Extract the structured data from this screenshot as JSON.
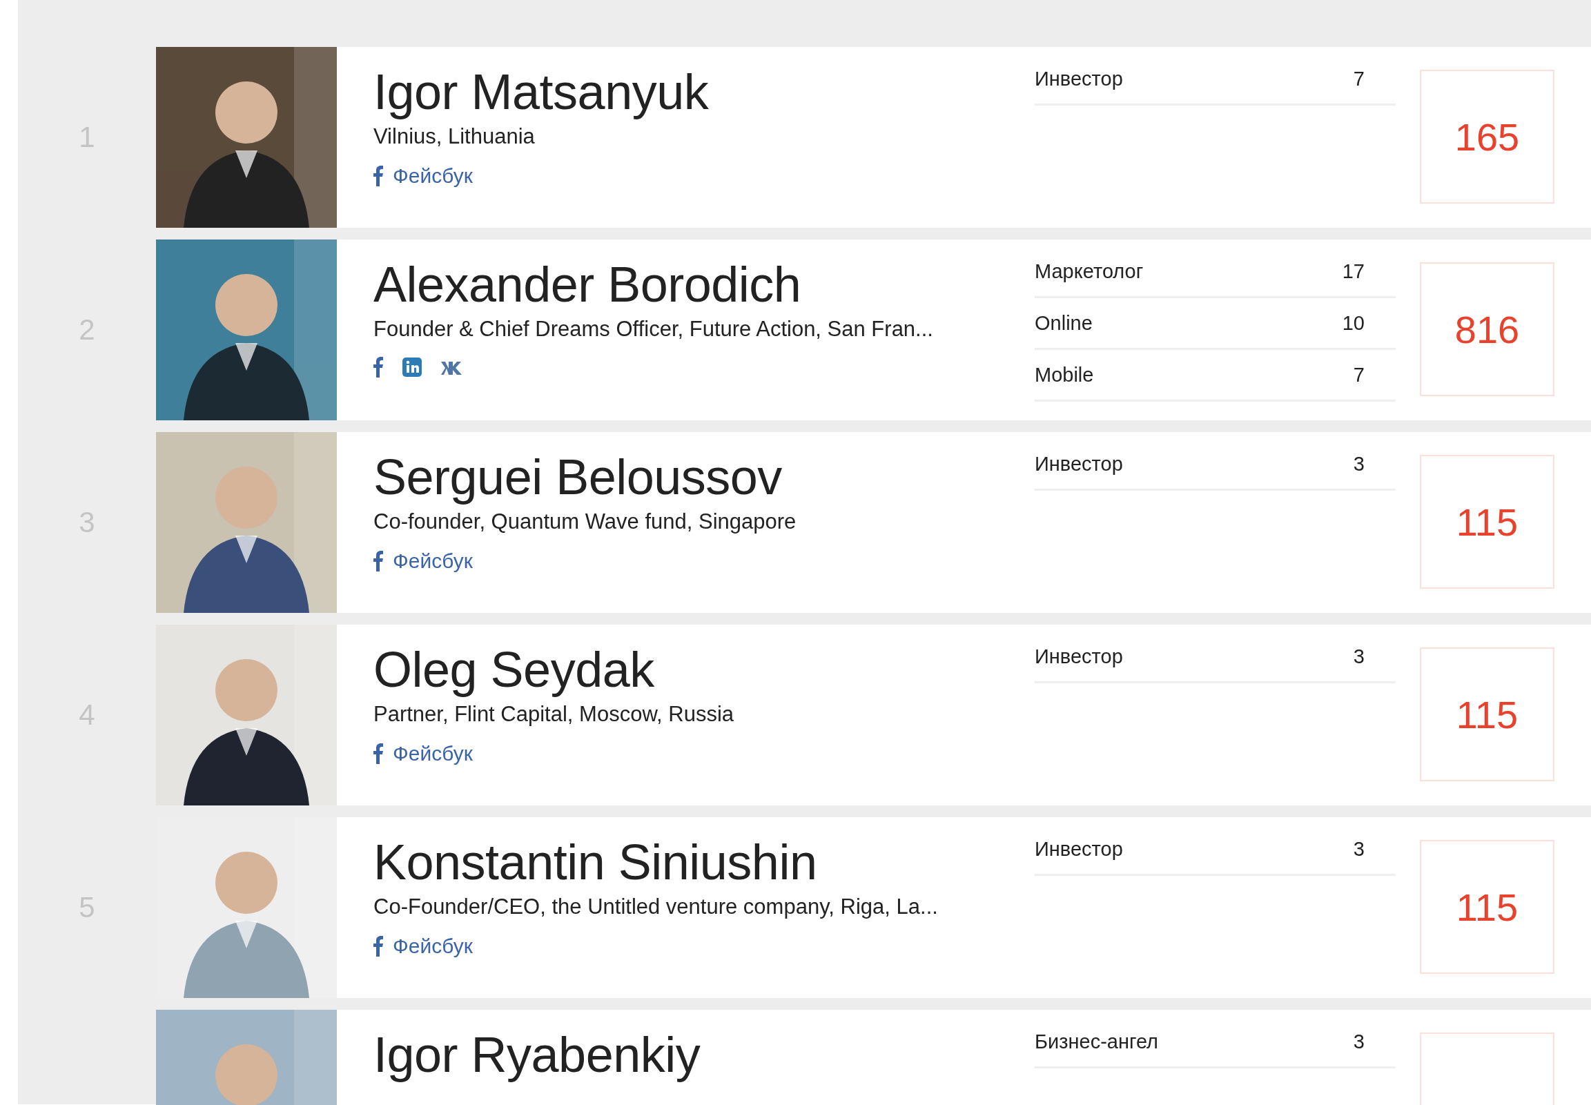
{
  "people": [
    {
      "rank": "1",
      "name": "Igor Matsanyuk",
      "subtitle": "Vilnius, Lithuania",
      "socials": [
        {
          "kind": "facebook",
          "label": "Фейсбук"
        }
      ],
      "tags": [
        {
          "label": "Инвестор",
          "count": "7"
        }
      ],
      "score": "165"
    },
    {
      "rank": "2",
      "name": "Alexander Borodich",
      "subtitle": "Founder & Chief Dreams Officer, Future Action, San Fran...",
      "socials": [
        {
          "kind": "facebook"
        },
        {
          "kind": "linkedin"
        },
        {
          "kind": "vk"
        }
      ],
      "tags": [
        {
          "label": "Маркетолог",
          "count": "17"
        },
        {
          "label": "Online",
          "count": "10"
        },
        {
          "label": "Mobile",
          "count": "7"
        }
      ],
      "score": "816"
    },
    {
      "rank": "3",
      "name": "Serguei Beloussov",
      "subtitle": "Co-founder, Quantum Wave fund, Singapore",
      "socials": [
        {
          "kind": "facebook",
          "label": "Фейсбук"
        }
      ],
      "tags": [
        {
          "label": "Инвестор",
          "count": "3"
        }
      ],
      "score": "115"
    },
    {
      "rank": "4",
      "name": "Oleg Seydak",
      "subtitle": "Partner, Flint Capital, Moscow, Russia",
      "socials": [
        {
          "kind": "facebook",
          "label": "Фейсбук"
        }
      ],
      "tags": [
        {
          "label": "Инвестор",
          "count": "3"
        }
      ],
      "score": "115"
    },
    {
      "rank": "5",
      "name": "Konstantin Siniushin",
      "subtitle": "Co-Founder/CEO, the Untitled venture company, Riga, La...",
      "socials": [
        {
          "kind": "facebook",
          "label": "Фейсбук"
        }
      ],
      "tags": [
        {
          "label": "Инвестор",
          "count": "3"
        }
      ],
      "score": "115"
    },
    {
      "name": "Igor Ryabenkiy",
      "tags": [
        {
          "label": "Бизнес-ангел",
          "count": "3"
        }
      ]
    }
  ]
}
